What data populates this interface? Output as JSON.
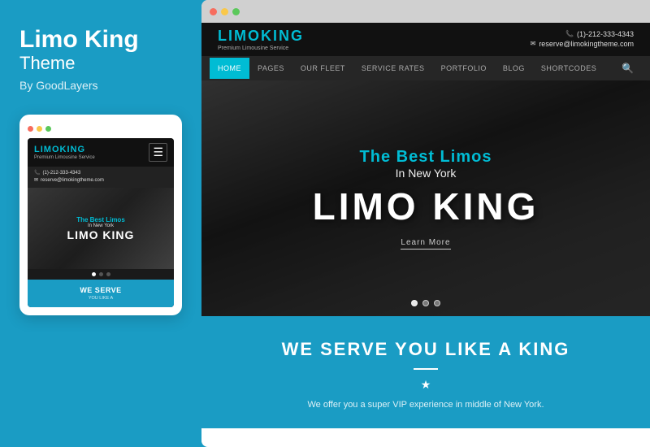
{
  "left": {
    "title": "Limo King",
    "subtitle": "Theme",
    "author": "By GoodLayers"
  },
  "mobile": {
    "dots": [
      "red",
      "yellow",
      "green"
    ],
    "logo_text": "LIMO",
    "logo_accent": "KING",
    "tagline": "Premium Limousine Service",
    "phone_icon": "📞",
    "phone": "(1)-212-333-4343",
    "email_icon": "✉",
    "email": "reserve@limokingtheme.com",
    "hero_best_limos": "The Best Limos",
    "hero_in_ny": "In New York",
    "hero_limo_king": "LIMO KING",
    "serve_title": "WE SERVE",
    "serve_subtitle": "YOU LIKE A"
  },
  "desktop": {
    "logo_text": "LIMO",
    "logo_accent": "KING",
    "tagline": "Premium Limousine Service",
    "phone": "(1)-212-333-4343",
    "email": "reserve@limokingtheme.com",
    "nav": [
      "HOME",
      "PAGES",
      "OUR FLEET",
      "SERVICE RATES",
      "PORTFOLIO",
      "BLOG",
      "SHORTCODES"
    ],
    "hero_best_limos": "The Best Limos",
    "hero_in_ny": "In New York",
    "hero_limo_king": "LIMO KING",
    "hero_learn_more": "Learn More",
    "serve_title": "WE SERVE YOU LIKE A KING",
    "serve_star": "★",
    "serve_desc": "We offer you a super VIP experience in middle of New York."
  }
}
